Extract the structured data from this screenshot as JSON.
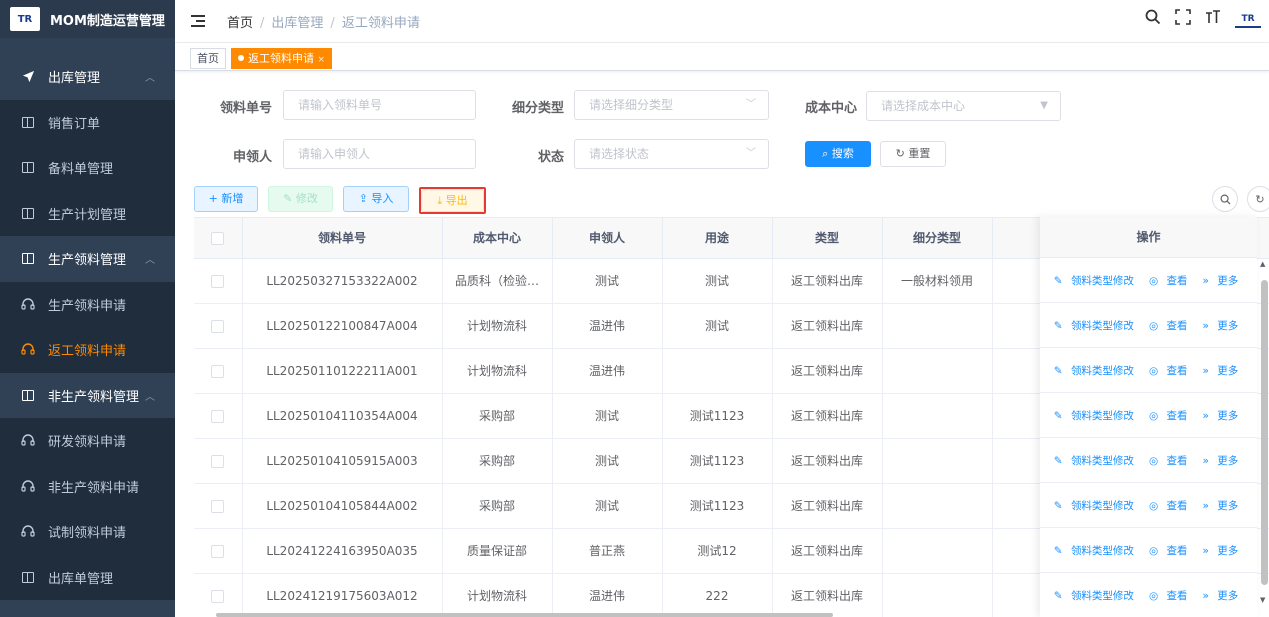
{
  "app": {
    "title": "MOM制造运营管理",
    "logo_text": "TR"
  },
  "sidebar": {
    "items": [
      {
        "label": "出库管理",
        "level": "group",
        "state": "open"
      },
      {
        "label": "销售订单",
        "level": "sub"
      },
      {
        "label": "备料单管理",
        "level": "sub"
      },
      {
        "label": "生产计划管理",
        "level": "sub"
      },
      {
        "label": "生产领料管理",
        "level": "group",
        "state": "open"
      },
      {
        "label": "生产领料申请",
        "level": "sub"
      },
      {
        "label": "返工领料申请",
        "level": "sub",
        "state": "active"
      },
      {
        "label": "非生产领料管理",
        "level": "group",
        "state": "open"
      },
      {
        "label": "研发领料申请",
        "level": "sub"
      },
      {
        "label": "非生产领料申请",
        "level": "sub"
      },
      {
        "label": "试制领料申请",
        "level": "sub"
      },
      {
        "label": "出库单管理",
        "level": "sub"
      }
    ]
  },
  "breadcrumb": [
    "首页",
    "出库管理",
    "返工领料申请"
  ],
  "tags": [
    {
      "label": "首页",
      "active": false
    },
    {
      "label": "返工领料申请",
      "active": true,
      "close": "×"
    }
  ],
  "search": {
    "order_no_label": "领料单号",
    "order_no_placeholder": "请输入领料单号",
    "subtype_label": "细分类型",
    "subtype_placeholder": "请选择细分类型",
    "cost_center_label": "成本中心",
    "cost_center_placeholder": "请选择成本中心",
    "applicant_label": "申领人",
    "applicant_placeholder": "请输入申领人",
    "status_label": "状态",
    "status_placeholder": "请选择状态",
    "search_btn": "搜索",
    "reset_btn": "重置"
  },
  "toolbar": {
    "add": "新增",
    "edit": "修改",
    "import": "导入",
    "export": "导出"
  },
  "table": {
    "columns": [
      "领料单号",
      "成本中心",
      "申领人",
      "用途",
      "类型",
      "细分类型",
      "操作"
    ],
    "rows": [
      {
        "no": "LL20250327153322A002",
        "cost_center": "品质科（检验…",
        "applicant": "测试",
        "purpose": "测试",
        "type": "返工领料出库",
        "subtype": "一般材料领用"
      },
      {
        "no": "LL20250122100847A004",
        "cost_center": "计划物流科",
        "applicant": "温进伟",
        "purpose": "测试",
        "type": "返工领料出库",
        "subtype": ""
      },
      {
        "no": "LL20250110122211A001",
        "cost_center": "计划物流科",
        "applicant": "温进伟",
        "purpose": "",
        "type": "返工领料出库",
        "subtype": ""
      },
      {
        "no": "LL20250104110354A004",
        "cost_center": "采购部",
        "applicant": "测试",
        "purpose": "测试1123",
        "type": "返工领料出库",
        "subtype": ""
      },
      {
        "no": "LL20250104105915A003",
        "cost_center": "采购部",
        "applicant": "测试",
        "purpose": "测试1123",
        "type": "返工领料出库",
        "subtype": ""
      },
      {
        "no": "LL20250104105844A002",
        "cost_center": "采购部",
        "applicant": "测试",
        "purpose": "测试1123",
        "type": "返工领料出库",
        "subtype": ""
      },
      {
        "no": "LL20241224163950A035",
        "cost_center": "质量保证部",
        "applicant": "普正燕",
        "purpose": "测试12",
        "type": "返工领料出库",
        "subtype": ""
      },
      {
        "no": "LL20241219175603A012",
        "cost_center": "计划物流科",
        "applicant": "温进伟",
        "purpose": "222",
        "type": "返工领料出库",
        "subtype": ""
      }
    ],
    "row_actions": {
      "edit_type": "领料类型修改",
      "view": "查看",
      "more": "更多"
    }
  },
  "colors": {
    "sidebar_bg": "#304156",
    "accent": "#ff8a00",
    "primary": "#1890ff",
    "highlight": "#e53935"
  }
}
